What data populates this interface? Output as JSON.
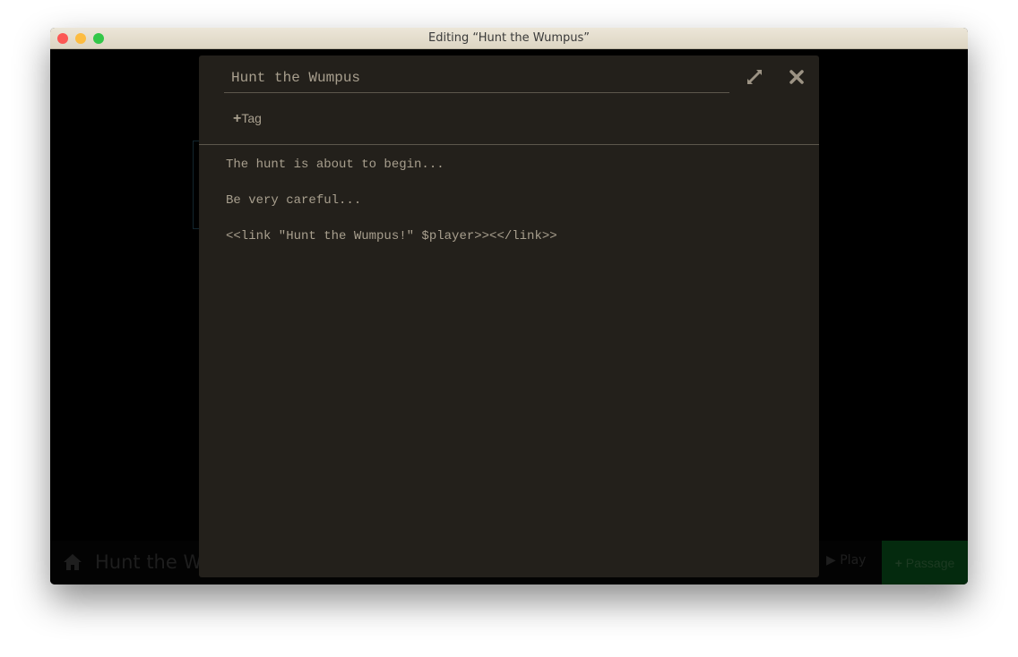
{
  "window": {
    "title": "Editing “Hunt the Wumpus”"
  },
  "toolbar": {
    "story_title": "Hunt the W",
    "play_label": "Play",
    "passage_label": "Passage",
    "passage_color": "#042a0e"
  },
  "dialog": {
    "passage_name": "Hunt the Wumpus",
    "tag_label": "Tag",
    "text": "The hunt is about to begin...\n\nBe very careful...\n\n<<link \"Hunt the Wumpus!\" $player>><</link>>",
    "icons": {
      "maximize": "expand-icon",
      "close": "close-icon"
    }
  }
}
